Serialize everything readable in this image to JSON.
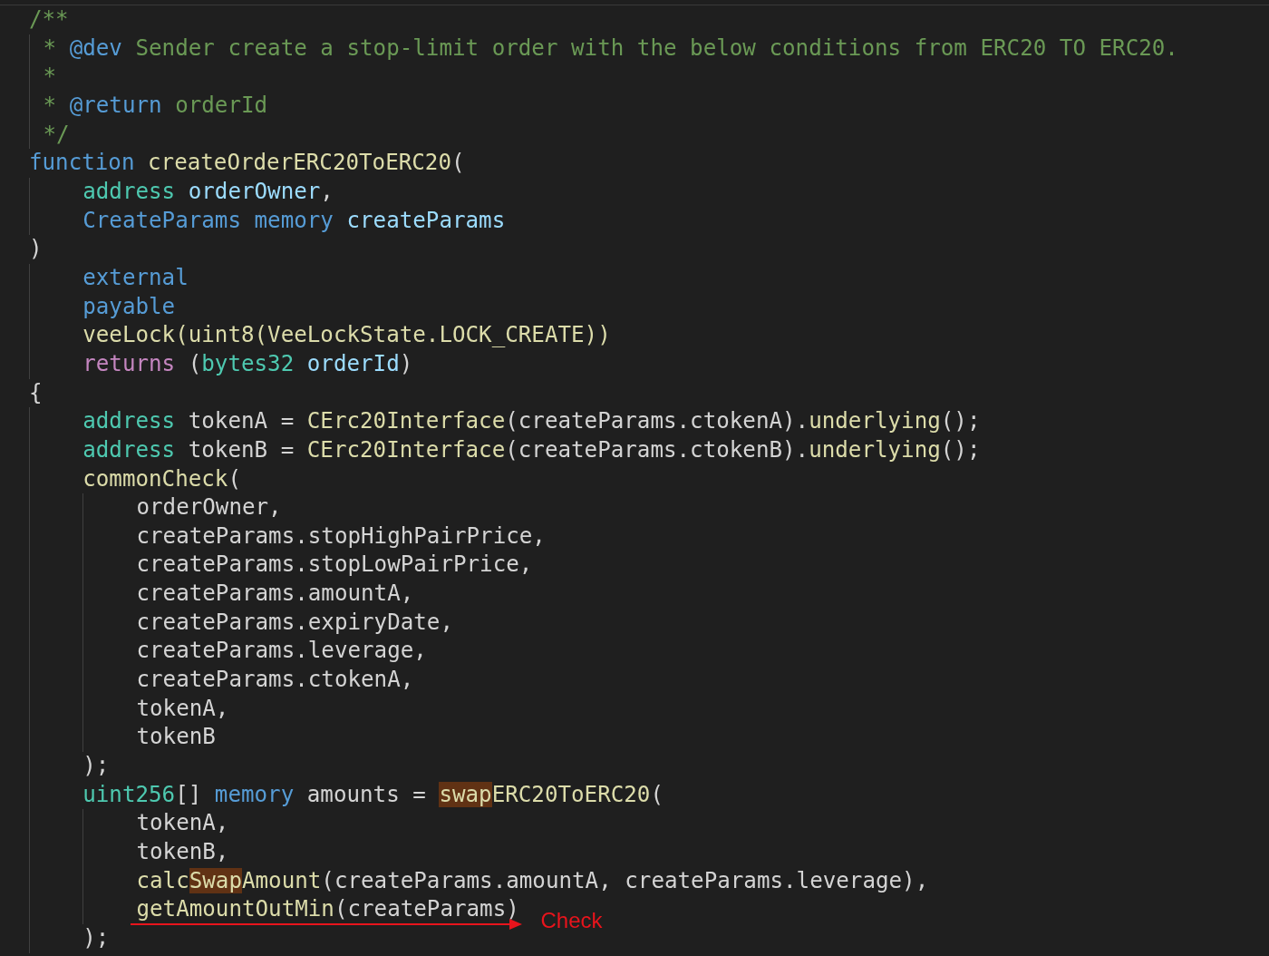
{
  "editor": {
    "lines": [
      {
        "kind": "comment",
        "tokens": [
          {
            "text": "/**",
            "kind": "comment"
          }
        ],
        "children": [
          {
            "tokens": [
              {
                "text": " * ",
                "kind": "comment"
              },
              {
                "text": "@dev",
                "kind": "doctag"
              },
              {
                "text": " Sender create a stop-limit order with the below conditions from ERC20 TO ERC20.",
                "kind": "comment"
              }
            ]
          },
          {
            "tokens": [
              {
                "text": " *",
                "kind": "comment"
              }
            ]
          },
          {
            "tokens": [
              {
                "text": " * ",
                "kind": "comment"
              },
              {
                "text": "@return",
                "kind": "doctag"
              },
              {
                "text": " orderId",
                "kind": "comment"
              }
            ]
          },
          {
            "tokens": [
              {
                "text": " */",
                "kind": "comment"
              }
            ]
          }
        ]
      },
      {
        "tokens": [
          {
            "text": "function ",
            "kind": "keyword"
          },
          {
            "text": "createOrderERC20ToERC20",
            "kind": "func"
          },
          {
            "text": "(",
            "kind": "plain"
          }
        ],
        "children": [
          {
            "tokens": [
              {
                "text": "address ",
                "kind": "type"
              },
              {
                "text": "orderOwner",
                "kind": "var"
              },
              {
                "text": ",",
                "kind": "plain"
              }
            ]
          },
          {
            "tokens": [
              {
                "text": "CreateParams memory ",
                "kind": "keyword"
              },
              {
                "text": "createParams",
                "kind": "var"
              }
            ]
          }
        ]
      },
      {
        "tokens": [
          {
            "text": ")",
            "kind": "plain"
          }
        ],
        "children": [
          {
            "tokens": [
              {
                "text": "external",
                "kind": "keyword"
              }
            ]
          },
          {
            "tokens": [
              {
                "text": "payable",
                "kind": "keyword"
              }
            ]
          },
          {
            "tokens": [
              {
                "text": "veeLock(uint8(VeeLockState.LOCK_CREATE))",
                "kind": "func"
              }
            ]
          },
          {
            "tokens": [
              {
                "text": "returns",
                "kind": "control"
              },
              {
                "text": " (",
                "kind": "plain"
              },
              {
                "text": "bytes32 ",
                "kind": "type"
              },
              {
                "text": "orderId",
                "kind": "var"
              },
              {
                "text": ")",
                "kind": "plain"
              }
            ]
          }
        ]
      },
      {
        "tokens": [
          {
            "text": "{",
            "kind": "plain"
          }
        ],
        "children": [
          {
            "tokens": [
              {
                "text": "address",
                "kind": "type"
              },
              {
                "text": " tokenA = ",
                "kind": "plain"
              },
              {
                "text": "CErc20Interface",
                "kind": "func"
              },
              {
                "text": "(createParams.ctokenA).",
                "kind": "plain"
              },
              {
                "text": "underlying",
                "kind": "func"
              },
              {
                "text": "();",
                "kind": "plain"
              }
            ]
          },
          {
            "tokens": [
              {
                "text": "address",
                "kind": "type"
              },
              {
                "text": " tokenB = ",
                "kind": "plain"
              },
              {
                "text": "CErc20Interface",
                "kind": "func"
              },
              {
                "text": "(createParams.ctokenB).",
                "kind": "plain"
              },
              {
                "text": "underlying",
                "kind": "func"
              },
              {
                "text": "();",
                "kind": "plain"
              }
            ]
          },
          {
            "tokens": [
              {
                "text": "commonCheck",
                "kind": "func"
              },
              {
                "text": "(",
                "kind": "plain"
              }
            ],
            "children": [
              {
                "tokens": [
                  {
                    "text": "orderOwner,",
                    "kind": "plain"
                  }
                ]
              },
              {
                "tokens": [
                  {
                    "text": "createParams.stopHighPairPrice,",
                    "kind": "plain"
                  }
                ]
              },
              {
                "tokens": [
                  {
                    "text": "createParams.stopLowPairPrice,",
                    "kind": "plain"
                  }
                ]
              },
              {
                "tokens": [
                  {
                    "text": "createParams.amountA,",
                    "kind": "plain"
                  }
                ]
              },
              {
                "tokens": [
                  {
                    "text": "createParams.expiryDate,",
                    "kind": "plain"
                  }
                ]
              },
              {
                "tokens": [
                  {
                    "text": "createParams.leverage,",
                    "kind": "plain"
                  }
                ]
              },
              {
                "tokens": [
                  {
                    "text": "createParams.ctokenA,",
                    "kind": "plain"
                  }
                ]
              },
              {
                "tokens": [
                  {
                    "text": "tokenA,",
                    "kind": "plain"
                  }
                ]
              },
              {
                "tokens": [
                  {
                    "text": "tokenB",
                    "kind": "plain"
                  }
                ]
              }
            ]
          },
          {
            "tokens": [
              {
                "text": ");",
                "kind": "plain"
              }
            ]
          },
          {
            "tokens": [
              {
                "text": "uint256",
                "kind": "type"
              },
              {
                "text": "[] ",
                "kind": "plain"
              },
              {
                "text": "memory",
                "kind": "keyword"
              },
              {
                "text": " amounts = ",
                "kind": "plain"
              },
              {
                "text": "swap",
                "kind": "match"
              },
              {
                "text": "ERC20ToERC20",
                "kind": "func"
              },
              {
                "text": "(",
                "kind": "plain"
              }
            ],
            "children": [
              {
                "tokens": [
                  {
                    "text": "tokenA,",
                    "kind": "plain"
                  }
                ]
              },
              {
                "tokens": [
                  {
                    "text": "tokenB,",
                    "kind": "plain"
                  }
                ]
              },
              {
                "tokens": [
                  {
                    "text": "calc",
                    "kind": "func"
                  },
                  {
                    "text": "Swap",
                    "kind": "match"
                  },
                  {
                    "text": "Amount",
                    "kind": "func"
                  },
                  {
                    "text": "(createParams.amountA, createParams.leverage),",
                    "kind": "plain"
                  }
                ]
              },
              {
                "tokens": [
                  {
                    "text": "getAmountOutMin",
                    "kind": "func"
                  },
                  {
                    "text": "(createParams)",
                    "kind": "plain"
                  }
                ],
                "note": "Check"
              }
            ]
          },
          {
            "tokens": [
              {
                "text": ");",
                "kind": "plain"
              }
            ]
          }
        ]
      }
    ]
  }
}
